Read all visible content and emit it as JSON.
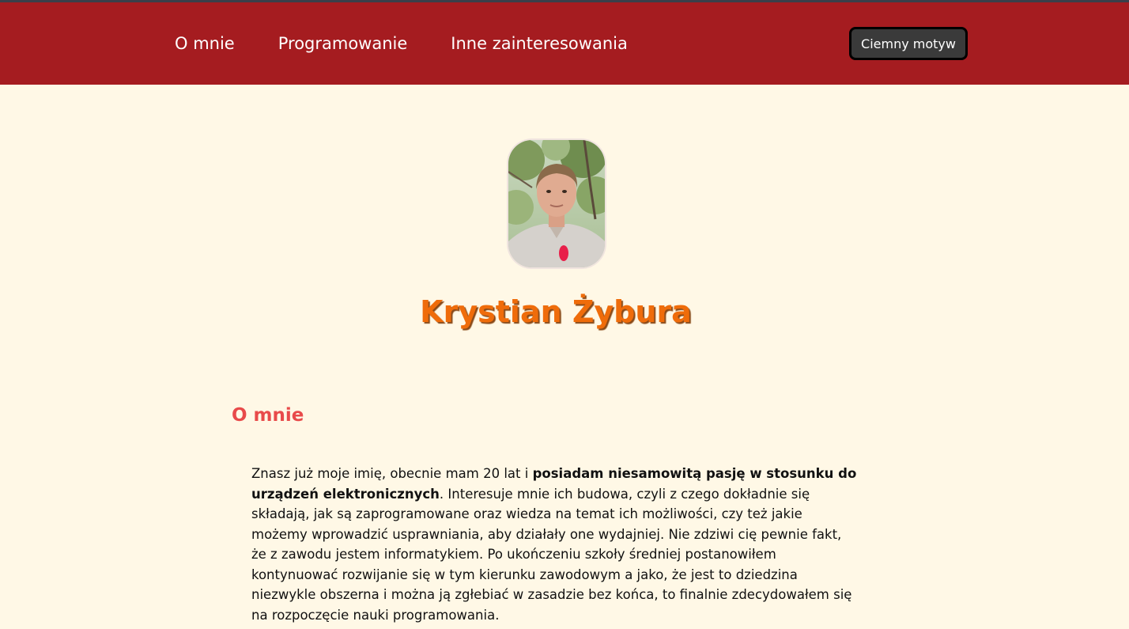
{
  "nav": {
    "items": [
      "O mnie",
      "Programowanie",
      "Inne zainteresowania"
    ],
    "theme_button": "Ciemny motyw"
  },
  "profile": {
    "name": "Krystian Żybura"
  },
  "about": {
    "title": "O mnie",
    "text_part1": "Znasz już moje imię, obecnie mam 20 lat i ",
    "text_bold": "posiadam niesamowitą pasję w stosunku do urządzeń elektronicznych",
    "text_part2": ". Interesuje mnie ich budowa, czyli z czego dokładnie się składają, jak są zaprogramowane oraz wiedza na temat ich możliwości, czy też jakie możemy wprowadzić usprawniania, aby działały one wydajniej. Nie zdziwi cię pewnie fakt, że z zawodu jestem informatykiem. Po ukończeniu szkoły średniej postanowiłem kontynuować rozwijanie się w tym kierunku zawodowym a jako, że jest to dziedzina niezwykle obszerna i można ją zgłebiać w zasadzie bez końca, to finalnie zdecydowałem się na rozpoczęcie nauki programowania."
  },
  "colors": {
    "header_bg": "#a51c20",
    "page_bg": "#fff8e6",
    "name_color": "#ef6c0a",
    "section_title_color": "#e84a4a"
  }
}
